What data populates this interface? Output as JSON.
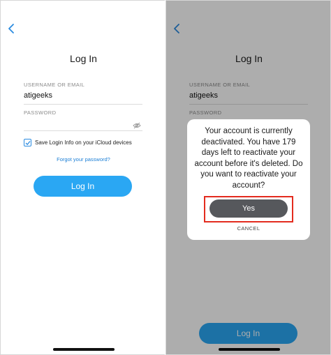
{
  "left_screen": {
    "title": "Log In",
    "username_label": "USERNAME OR EMAIL",
    "username_value": "atigeeks",
    "password_label": "PASSWORD",
    "save_login_label": "Save Login Info on your iCloud devices",
    "save_login_checked": true,
    "forgot_password": "Forgot your password?",
    "login_button": "Log In"
  },
  "right_screen": {
    "title": "Log In",
    "username_label": "USERNAME OR EMAIL",
    "username_value": "atigeeks",
    "password_label": "PASSWORD",
    "login_button": "Log In",
    "dialog": {
      "message": "Your account is currently deactivated. You have 179 days left to reactivate your account before it's deleted. Do you want to reactivate your account?",
      "yes_button": "Yes",
      "cancel_button": "CANCEL"
    }
  },
  "icons": [
    "back-chevron-icon",
    "eye-hidden-icon",
    "checkmark-icon"
  ],
  "colors": {
    "accent_blue": "#2aa7f3",
    "link_blue": "#1c7fd6",
    "highlight_red": "#e32b1e",
    "yes_button_gray": "#56585c"
  }
}
